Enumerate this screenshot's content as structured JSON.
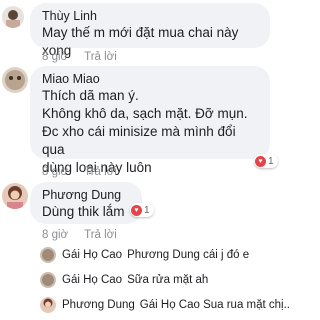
{
  "comments": [
    {
      "name": "Thùy Linh",
      "text": [
        "May thế m mới đặt mua chai này xong"
      ],
      "time": "8 giờ",
      "reply": "Trả lời"
    },
    {
      "name": "Miao Miao",
      "text": [
        "Thích dã man ý.",
        "Không khô da, sạch mặt. Đỡ mụn.",
        "Đc xho cái minisize mà mình đổi qua",
        "dùng loại này luôn"
      ],
      "time": "8 giờ",
      "reply": "Trả lời",
      "reaction_count": "1"
    },
    {
      "name": "Phương Dung",
      "text": [
        "Dùng thik lắm"
      ],
      "time": "8 giờ",
      "reply": "Trả lời",
      "reaction_count": "1"
    }
  ],
  "replies": [
    {
      "name": "Gái Họ Cao",
      "text": "Phương Dung  cái j đó e"
    },
    {
      "name": "Gái Họ Cao",
      "text": "Sữa rửa mặt ah"
    },
    {
      "name": "Phương Dung",
      "text": "Gái Họ Cao  Sua rua mặt chị.."
    }
  ],
  "colors": {
    "bubble": "#f0f2f5",
    "meta": "#8a8d91",
    "heart": "#e4434a"
  }
}
